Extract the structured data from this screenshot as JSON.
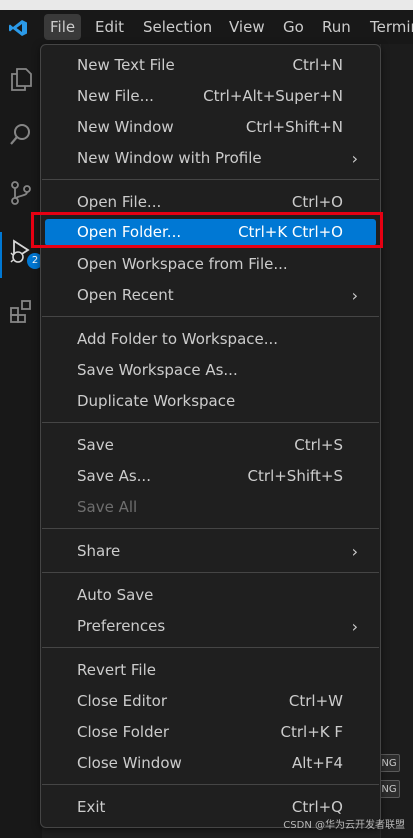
{
  "menubar": {
    "items": [
      "File",
      "Edit",
      "Selection",
      "View",
      "Go",
      "Run",
      "Termin"
    ]
  },
  "activitybar": {
    "icons": [
      "explorer-icon",
      "search-icon",
      "source-control-icon",
      "run-debug-icon",
      "extensions-icon"
    ],
    "run_badge": "2"
  },
  "file_menu": {
    "items": [
      {
        "label": "New Text File",
        "shortcut": "Ctrl+N"
      },
      {
        "label": "New File...",
        "shortcut": "Ctrl+Alt+Super+N"
      },
      {
        "label": "New Window",
        "shortcut": "Ctrl+Shift+N"
      },
      {
        "label": "New Window with Profile",
        "shortcut": "",
        "submenu": true
      },
      {
        "label": "Open File...",
        "shortcut": "Ctrl+O"
      },
      {
        "label": "Open Folder...",
        "shortcut": "Ctrl+K Ctrl+O",
        "highlighted": true
      },
      {
        "label": "Open Workspace from File...",
        "shortcut": ""
      },
      {
        "label": "Open Recent",
        "shortcut": "",
        "submenu": true
      },
      {
        "label": "Add Folder to Workspace...",
        "shortcut": ""
      },
      {
        "label": "Save Workspace As...",
        "shortcut": ""
      },
      {
        "label": "Duplicate Workspace",
        "shortcut": ""
      },
      {
        "label": "Save",
        "shortcut": "Ctrl+S"
      },
      {
        "label": "Save As...",
        "shortcut": "Ctrl+Shift+S"
      },
      {
        "label": "Save All",
        "shortcut": "",
        "disabled": true
      },
      {
        "label": "Share",
        "shortcut": "",
        "submenu": true
      },
      {
        "label": "Auto Save",
        "shortcut": ""
      },
      {
        "label": "Preferences",
        "shortcut": "",
        "submenu": true
      },
      {
        "label": "Revert File",
        "shortcut": ""
      },
      {
        "label": "Close Editor",
        "shortcut": "Ctrl+W"
      },
      {
        "label": "Close Folder",
        "shortcut": "Ctrl+K F"
      },
      {
        "label": "Close Window",
        "shortcut": "Alt+F4"
      },
      {
        "label": "Exit",
        "shortcut": "Ctrl+Q"
      }
    ]
  },
  "background": {
    "chips": [
      "NG",
      "NG"
    ]
  },
  "watermark": "CSDN @华为云开发者联盟",
  "colors": {
    "accent": "#0078d4",
    "annotation_box": "#e60012",
    "menu_bg": "#1f1f1f"
  }
}
